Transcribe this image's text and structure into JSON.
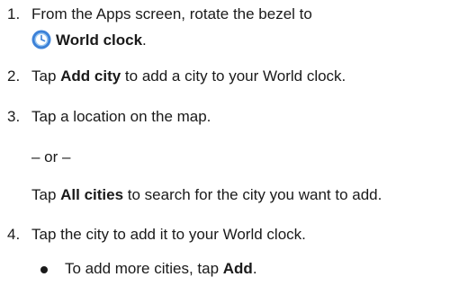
{
  "steps": [
    {
      "number": "1.",
      "line1": "From the Apps screen, rotate the bezel to",
      "line2_bold": "World clock",
      "line2_suffix": ".",
      "icon": "world-clock-icon"
    },
    {
      "number": "2.",
      "prefix": "Tap ",
      "bold": "Add city",
      "suffix": " to add a city to your World clock."
    },
    {
      "number": "3.",
      "text": "Tap a location on the map."
    },
    {
      "or_text": "– or –"
    },
    {
      "prefix": "Tap ",
      "bold": "All cities",
      "suffix": " to search for the city you want to add."
    },
    {
      "number": "4.",
      "text": "Tap the city to add it to your World clock."
    },
    {
      "bullet_prefix": "To add more cities, tap ",
      "bullet_bold": "Add",
      "bullet_suffix": "."
    }
  ],
  "colors": {
    "text": "#1a1a1a",
    "icon_blue": "#3d82d8",
    "icon_light": "#9cc8f2"
  }
}
